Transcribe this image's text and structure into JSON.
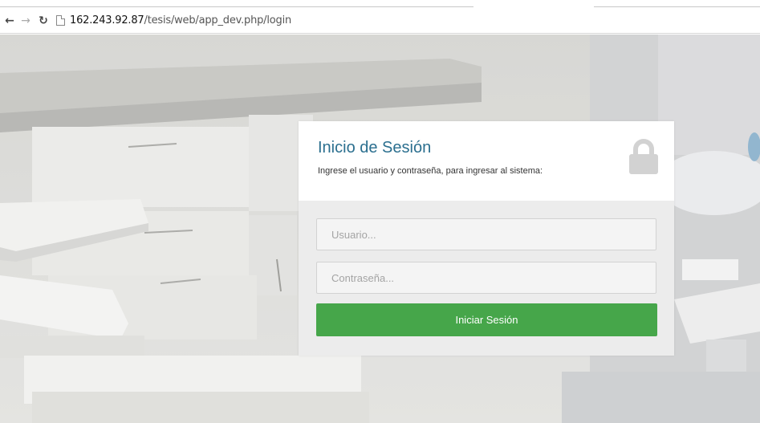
{
  "browser": {
    "url_host": "162.243.92.87",
    "url_path": "/tesis/web/app_dev.php/login"
  },
  "login": {
    "title": "Inicio de Sesión",
    "subtitle": "Ingrese el usuario y contraseña, para ingresar al sistema:",
    "username_placeholder": "Usuario...",
    "password_placeholder": "Contraseña...",
    "submit_label": "Iniciar Sesión"
  },
  "colors": {
    "title": "#2b6f8f",
    "submit_button": "#46a64a"
  },
  "icons": [
    "back-arrow-icon",
    "forward-arrow-icon",
    "reload-icon",
    "page-icon",
    "lock-icon"
  ]
}
